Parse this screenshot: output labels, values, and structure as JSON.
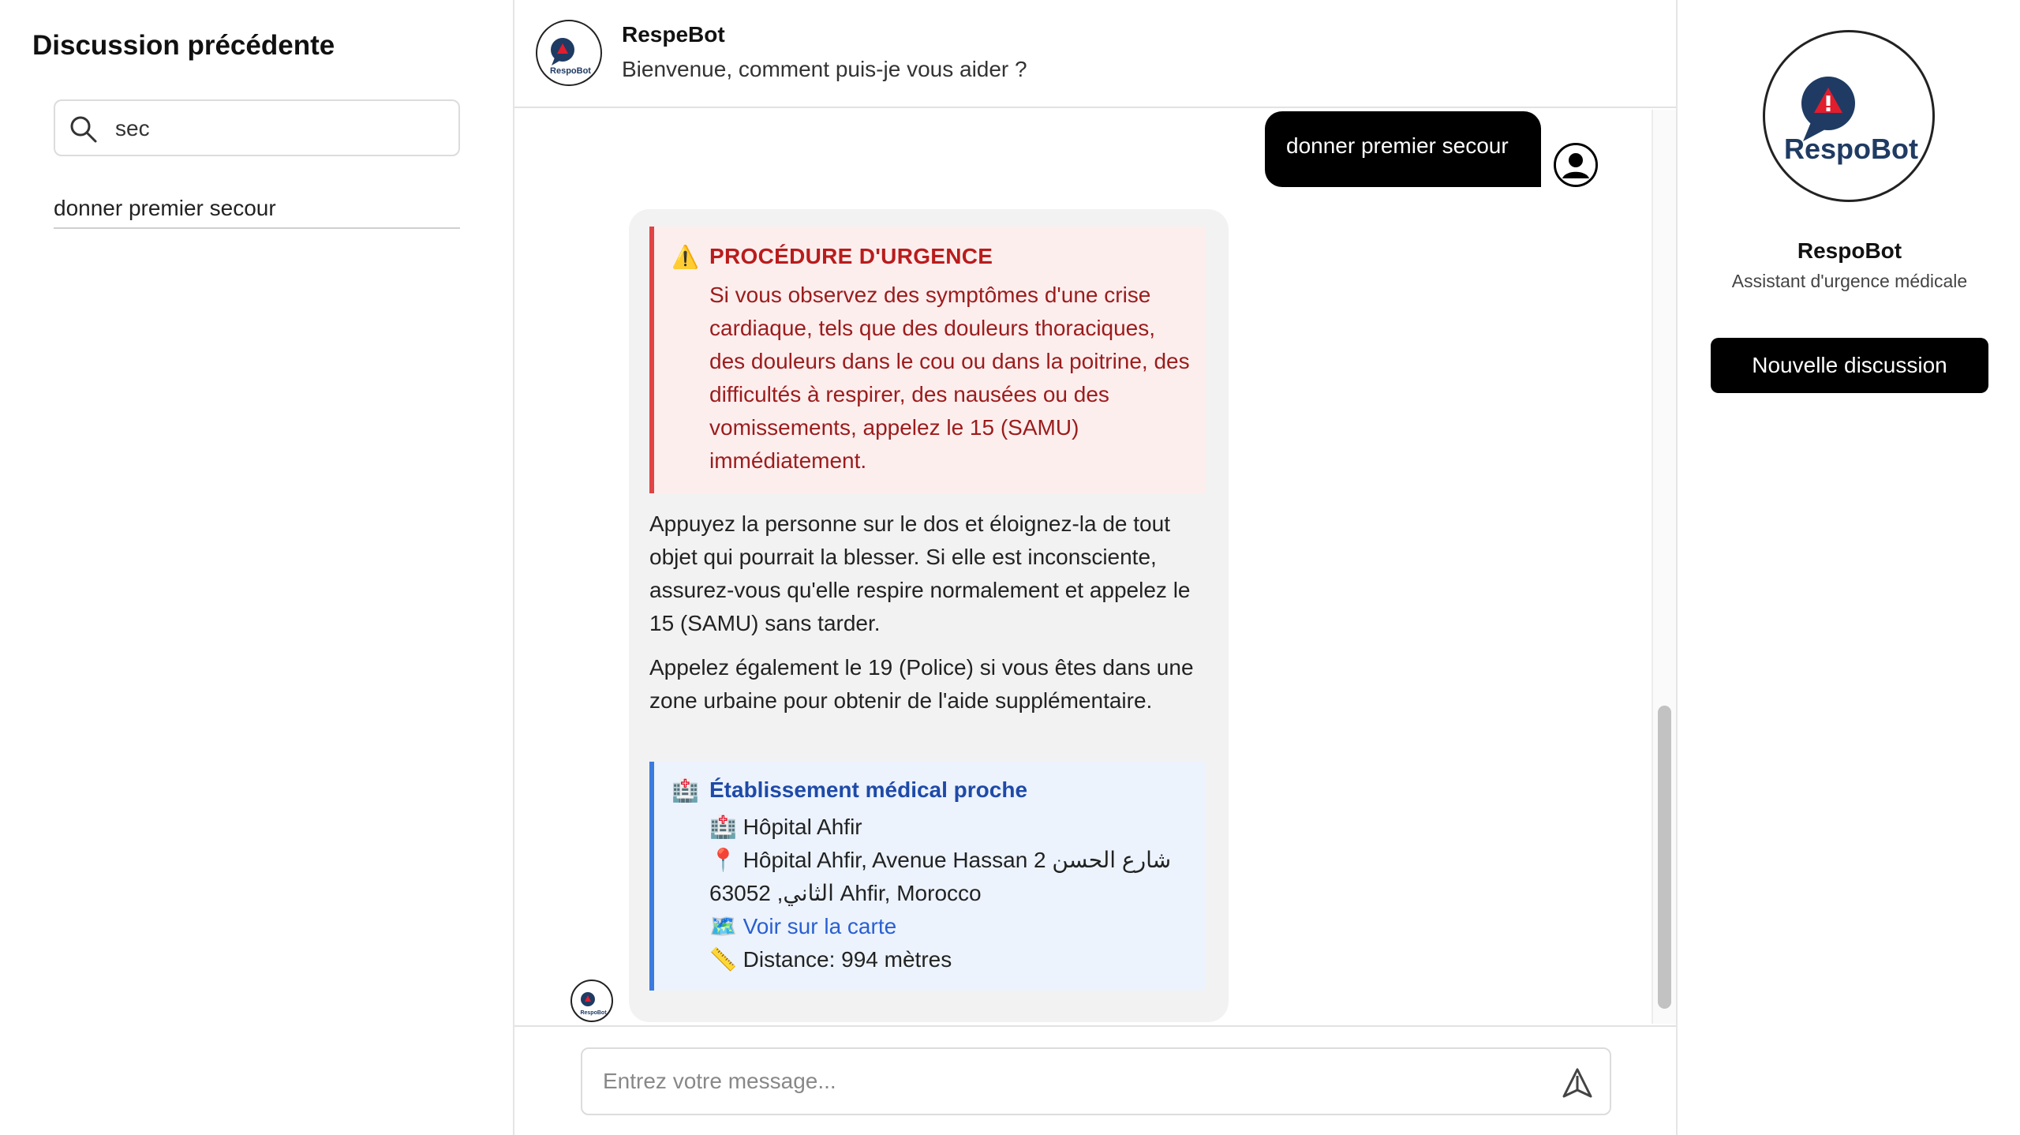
{
  "sidebar": {
    "title": "Discussion précédente",
    "search": {
      "value": "sec"
    },
    "history": [
      "donner premier secour"
    ]
  },
  "chat": {
    "header": {
      "name": "RespeBot",
      "subtitle": "Bienvenue, comment puis-je vous aider ?"
    },
    "messages": {
      "user": "donner premier secour",
      "bot": {
        "alert_title": "PROCÉDURE D'URGENCE",
        "alert_body": "Si vous observez des symptômes d'une crise cardiaque, tels que des douleurs thoraciques, des douleurs dans le cou ou dans la poitrine, des difficultés à respirer, des nausées ou des vomissements, appelez le 15 (SAMU) immédiatement.",
        "paragraph1": "Appuyez la personne sur le dos et éloignez-la de tout objet qui pourrait la blesser. Si elle est inconsciente, assurez-vous qu'elle respire normalement et appelez le 15 (SAMU) sans tarder.",
        "paragraph2": "Appelez également le 19 (Police) si vous êtes dans une zone urbaine pour obtenir de l'aide supplémentaire.",
        "hospital": {
          "title": "Établissement médical proche",
          "name": "Hôpital Ahfir",
          "address": "Hôpital Ahfir, Avenue Hassan 2 شارع الحسن الثاني, 63052 Ahfir, Morocco",
          "map_link": "Voir sur la carte",
          "distance": "Distance: 994 mètres"
        }
      }
    },
    "composer": {
      "placeholder": "Entrez votre message..."
    }
  },
  "profile": {
    "logo_text": "RespoBot",
    "name": "RespoBot",
    "subtitle": "Assistant d'urgence médicale",
    "new_button": "Nouvelle discussion"
  },
  "icons": {
    "search": "search-icon",
    "user": "user-icon",
    "send": "send-icon",
    "warning": "⚠️",
    "hospital": "🏥",
    "pin": "📍",
    "map": "🗺️",
    "ruler": "📏"
  },
  "colors": {
    "alert_bg": "#fdeeee",
    "alert_border": "#e04444",
    "alert_text": "#9b1c1c",
    "info_bg": "#ecf3fd",
    "info_border": "#3b7be0",
    "link": "#2a5fd0",
    "logo_blue": "#1f3b63",
    "logo_red": "#e11d2e"
  }
}
